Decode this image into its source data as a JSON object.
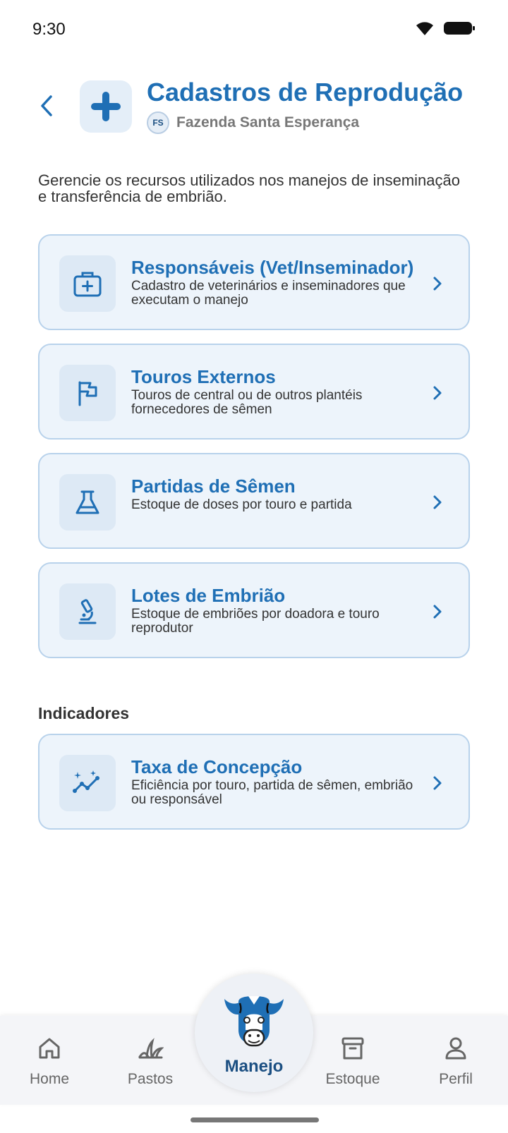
{
  "status_bar": {
    "time": "9:30",
    "icons": [
      "wifi-icon",
      "battery-icon"
    ]
  },
  "header": {
    "title": "Cadastros de Reprodução",
    "farm_badge": "FS",
    "farm_name": "Fazenda Santa Esperança",
    "icons": {
      "back": "chevron-left-icon",
      "main": "plus-icon"
    }
  },
  "description": "Gerencie os recursos utilizados nos manejos de inseminação e transferência de embrião.",
  "cards": [
    {
      "title": "Responsáveis (Vet/Inseminador)",
      "subtitle": "Cadastro de veterinários e inseminadores que executam o manejo",
      "icon": "medical-bag-icon"
    },
    {
      "title": "Touros Externos",
      "subtitle": "Touros de central ou de outros plantéis fornecedores de sêmen",
      "icon": "flag-icon"
    },
    {
      "title": "Partidas de Sêmen",
      "subtitle": "Estoque de doses por touro e partida",
      "icon": "flask-icon"
    },
    {
      "title": "Lotes de Embrião",
      "subtitle": "Estoque de embriões por doadora e touro reprodutor",
      "icon": "microscope-icon"
    }
  ],
  "indicators": {
    "section_label": "Indicadores",
    "cards": [
      {
        "title": "Taxa de Concepção",
        "subtitle": "Eficiência por touro, partida de sêmen, embrião ou responsável",
        "icon": "chart-sparkle-icon"
      }
    ]
  },
  "bottom_nav": {
    "items": [
      {
        "label": "Home",
        "icon": "home-icon"
      },
      {
        "label": "Pastos",
        "icon": "grass-icon"
      },
      {
        "label": "Manejo",
        "icon": "cow-icon",
        "active": true
      },
      {
        "label": "Estoque",
        "icon": "archive-box-icon"
      },
      {
        "label": "Perfil",
        "icon": "person-icon"
      }
    ]
  },
  "colors": {
    "primary": "#1f6fb5",
    "card_bg": "#edf4fb",
    "card_border": "#b8d2eb",
    "nav_bg": "#f4f5f8"
  }
}
